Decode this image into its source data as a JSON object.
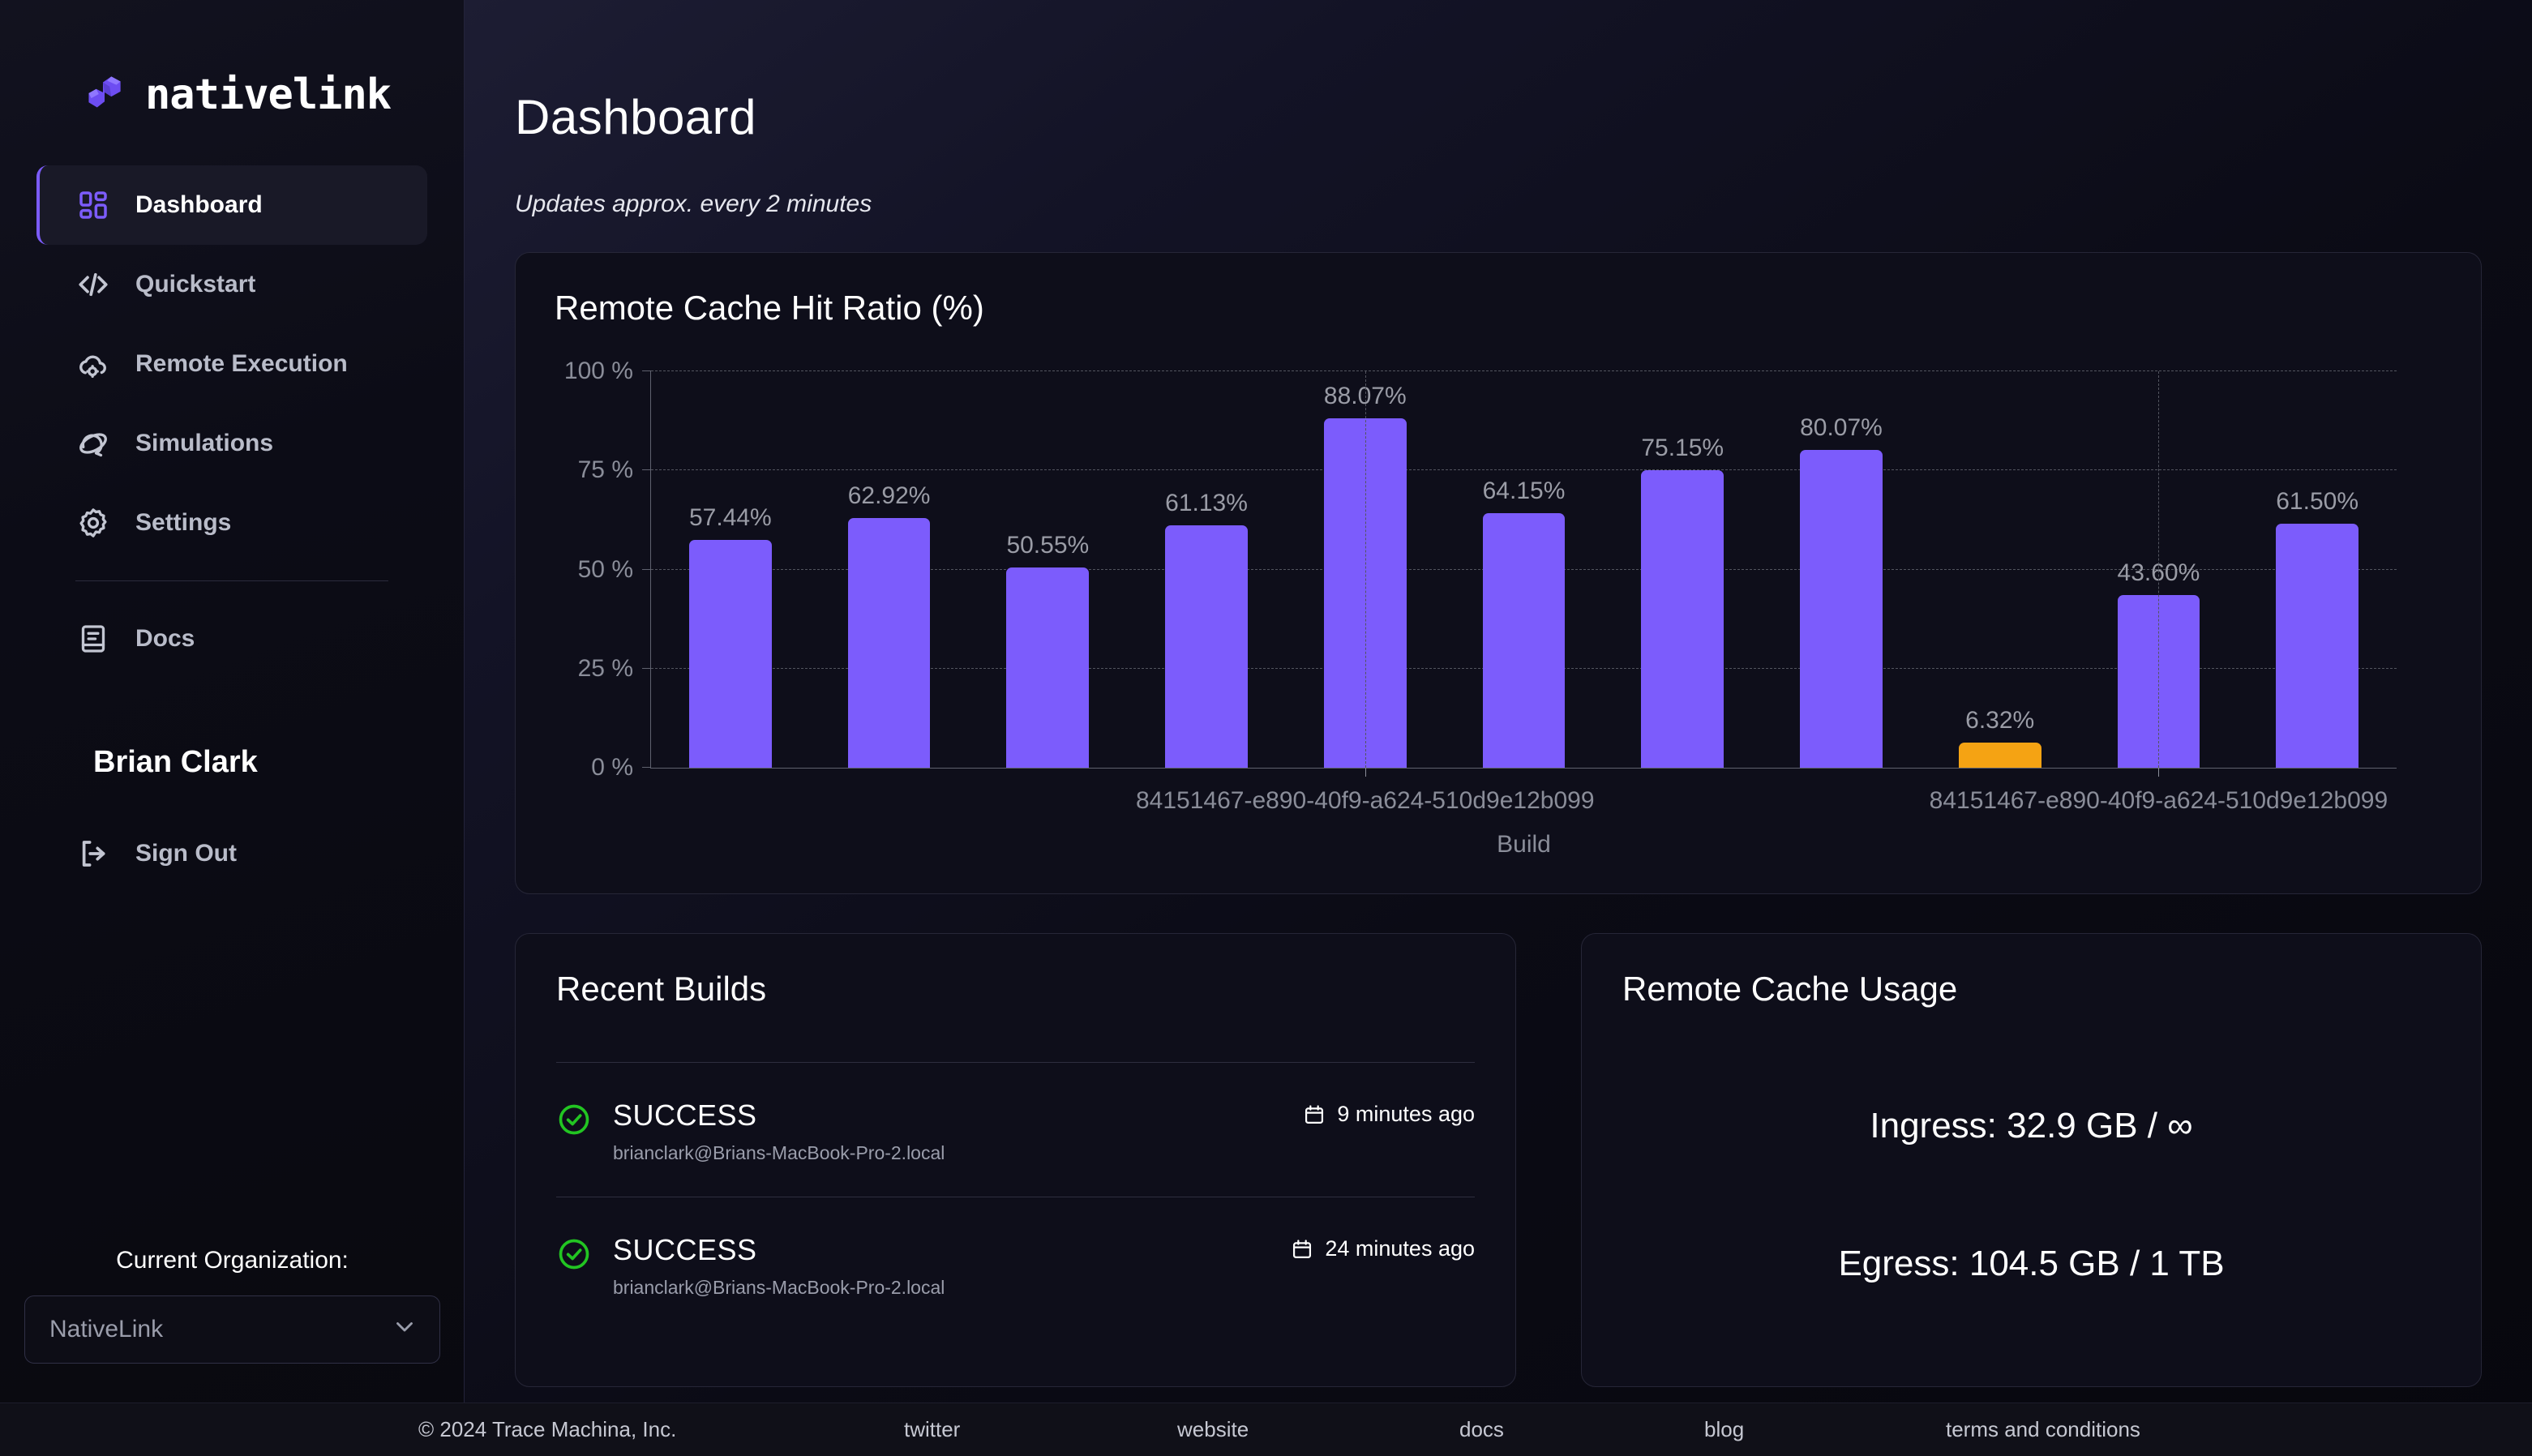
{
  "brand": {
    "name": "nativelink"
  },
  "sidebar": {
    "items": [
      {
        "label": "Dashboard",
        "icon": "grid-icon",
        "active": true
      },
      {
        "label": "Quickstart",
        "icon": "code-brackets-icon",
        "active": false
      },
      {
        "label": "Remote Execution",
        "icon": "cloud-gear-icon",
        "active": false
      },
      {
        "label": "Simulations",
        "icon": "orbit-icon",
        "active": false
      },
      {
        "label": "Settings",
        "icon": "gear-icon",
        "active": false
      },
      {
        "label": "Docs",
        "icon": "book-icon",
        "active": false
      }
    ],
    "user_name": "Brian Clark",
    "sign_out_label": "Sign Out",
    "sign_out_icon": "sign-out-icon",
    "org_label": "Current Organization:",
    "org_value": "NativeLink",
    "org_chevron_icon": "chevron-down-icon"
  },
  "header": {
    "title": "Dashboard",
    "subtitle": "Updates approx. every 2 minutes"
  },
  "chart_data": {
    "type": "bar",
    "title": "Remote Cache Hit Ratio (%)",
    "xlabel": "Build",
    "ylabel": "",
    "ylim": [
      0,
      100
    ],
    "grid": true,
    "legend": "none",
    "ytick_labels": [
      "0 %",
      "25 %",
      "50 %",
      "75 %",
      "100 %"
    ],
    "ytick_values": [
      0,
      25,
      50,
      75,
      100
    ],
    "categories": [
      "",
      "",
      "",
      "",
      "",
      "",
      "",
      "",
      "",
      "",
      ""
    ],
    "values": [
      57.44,
      62.92,
      50.55,
      61.13,
      88.07,
      64.15,
      75.15,
      80.07,
      6.32,
      43.6,
      61.5
    ],
    "data_labels": [
      "57.44%",
      "62.92%",
      "50.55%",
      "61.13%",
      "88.07%",
      "64.15%",
      "75.15%",
      "80.07%",
      "6.32%",
      "43.60%",
      "61.50%"
    ],
    "bar_colors": [
      "#7c5cfc",
      "#7c5cfc",
      "#7c5cfc",
      "#7c5cfc",
      "#7c5cfc",
      "#7c5cfc",
      "#7c5cfc",
      "#7c5cfc",
      "#f5a313",
      "#7c5cfc",
      "#7c5cfc"
    ],
    "xtick_labels": [
      "84151467-e890-40f9-a624-510d9e12b099",
      "84151467-e890-40f9-a624-510d9e12b099"
    ],
    "xtick_positions": [
      4,
      9
    ]
  },
  "builds": {
    "title": "Recent Builds",
    "rows": [
      {
        "status": "SUCCESS",
        "status_icon": "check-circle-icon",
        "host": "brianclark@Brians-MacBook-Pro-2.local",
        "time": "9 minutes ago",
        "time_icon": "calendar-icon"
      },
      {
        "status": "SUCCESS",
        "status_icon": "check-circle-icon",
        "host": "brianclark@Brians-MacBook-Pro-2.local",
        "time": "24 minutes ago",
        "time_icon": "calendar-icon"
      }
    ]
  },
  "usage": {
    "title": "Remote Cache Usage",
    "ingress": "Ingress: 32.9 GB / ∞",
    "egress": "Egress: 104.5 GB / 1 TB"
  },
  "footer": {
    "copyright": "© 2024 Trace Machina, Inc.",
    "links": [
      "twitter",
      "website",
      "docs",
      "blog",
      "terms and conditions"
    ]
  },
  "colors": {
    "accent": "#7c5cfc",
    "warning": "#f5a313",
    "success": "#22c522",
    "card_bg": "#0e0e1a",
    "card_border": "#262637"
  }
}
